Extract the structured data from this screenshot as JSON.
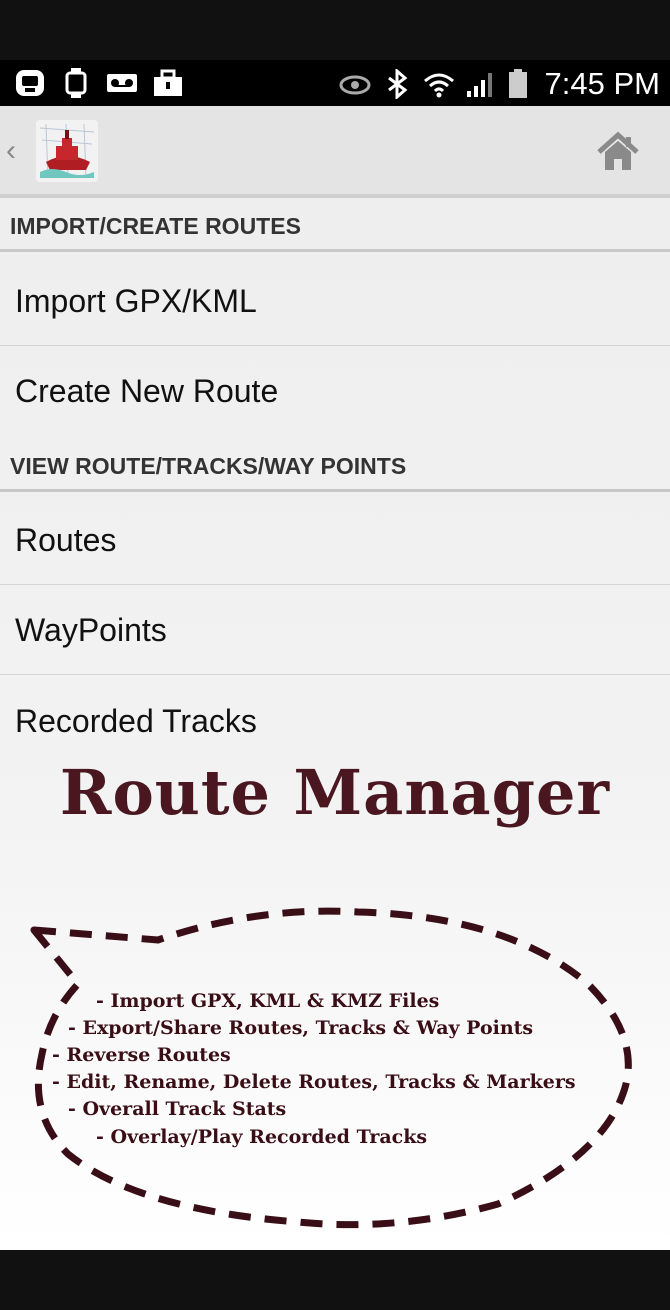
{
  "status_bar": {
    "time": "7:45 PM",
    "left_icons": [
      "app-notification-icon",
      "watch-icon",
      "voicemail-icon",
      "briefcase-icon"
    ],
    "right_icons": [
      "eye-icon",
      "bluetooth-icon",
      "wifi-icon",
      "signal-icon",
      "battery-icon"
    ]
  },
  "action_bar": {
    "back_glyph": "‹",
    "logo": "ship-logo-icon",
    "home": "home-icon"
  },
  "sections": [
    {
      "header": "IMPORT/CREATE ROUTES",
      "items": [
        "Import GPX/KML",
        "Create New Route"
      ]
    },
    {
      "header": "VIEW ROUTE/TRACKS/WAY POINTS",
      "items": [
        "Routes",
        "WayPoints",
        "Recorded Tracks"
      ]
    }
  ],
  "promo": {
    "title": "Route Manager",
    "features": [
      "- Import GPX, KML & KMZ Files",
      "- Export/Share Routes, Tracks & Way Points",
      "- Reverse Routes",
      "- Edit, Rename, Delete Routes, Tracks & Markers",
      "- Overall Track Stats",
      "- Overlay/Play Recorded Tracks"
    ]
  },
  "colors": {
    "promo_text": "#4a1720",
    "bubble_border": "#3a0e16",
    "action_bar_bg": "#e4e4e4"
  }
}
